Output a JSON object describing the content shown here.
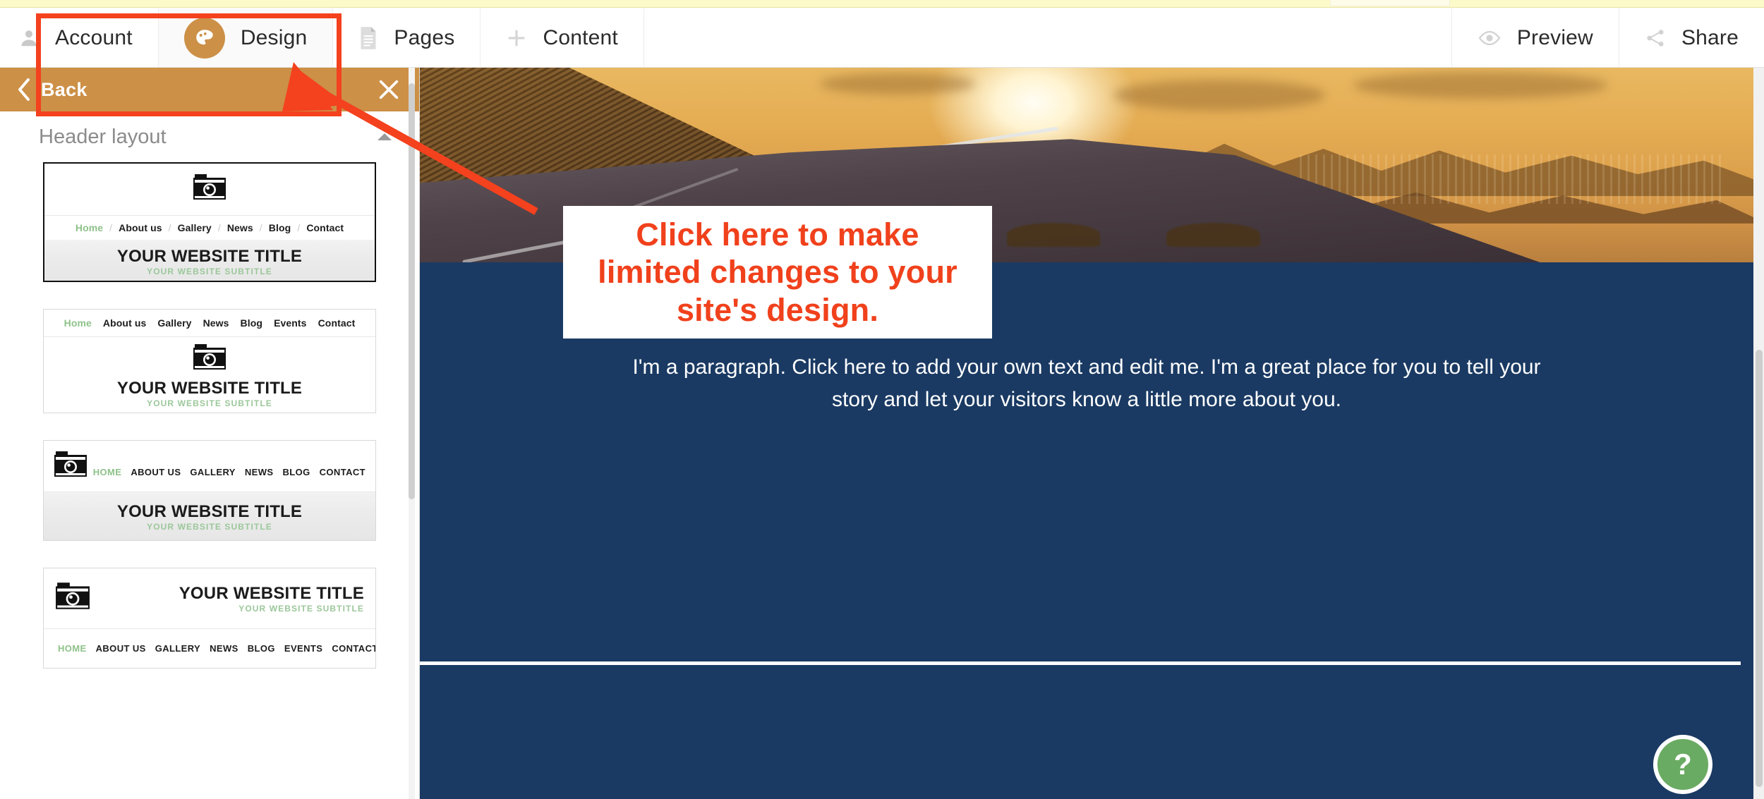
{
  "topbar": {
    "left_items": [
      {
        "label": "Account",
        "icon": "person-icon"
      },
      {
        "label": "Design",
        "icon": "palette-icon"
      },
      {
        "label": "Pages",
        "icon": "document-icon"
      },
      {
        "label": "Content",
        "icon": "plus-icon"
      }
    ],
    "right_items": [
      {
        "label": "Preview",
        "icon": "eye-icon"
      },
      {
        "label": "Share",
        "icon": "share-icon"
      }
    ],
    "active_item": "Design"
  },
  "panel": {
    "back_label": "Back",
    "close_label": "×",
    "section_title": "Header layout",
    "collapse_state": "expanded",
    "layouts": [
      {
        "id": "layout-1",
        "selected": true,
        "logo": "camera-icon",
        "nav": [
          "Home",
          "About us",
          "Gallery",
          "News",
          "Blog",
          "Contact"
        ],
        "nav_separator": "/",
        "nav_style": "mixed-case",
        "title": "YOUR WEBSITE TITLE",
        "subtitle": "YOUR WEBSITE SUBTITLE",
        "order": "logo-nav-banner"
      },
      {
        "id": "layout-2",
        "selected": false,
        "logo": "camera-icon",
        "nav": [
          "Home",
          "About us",
          "Gallery",
          "News",
          "Blog",
          "Events",
          "Contact"
        ],
        "nav_separator": "",
        "nav_style": "mixed-case",
        "title": "YOUR WEBSITE TITLE",
        "subtitle": "YOUR WEBSITE SUBTITLE",
        "order": "nav-logo-title"
      },
      {
        "id": "layout-3",
        "selected": false,
        "logo": "camera-icon",
        "nav": [
          "HOME",
          "ABOUT US",
          "GALLERY",
          "NEWS",
          "BLOG",
          "CONTACT"
        ],
        "nav_separator": "",
        "nav_style": "uppercase",
        "title": "YOUR WEBSITE TITLE",
        "subtitle": "YOUR WEBSITE SUBTITLE",
        "order": "logo-left-nav-right-banner"
      },
      {
        "id": "layout-4",
        "selected": false,
        "logo": "camera-icon",
        "nav": [
          "HOME",
          "ABOUT US",
          "GALLERY",
          "NEWS",
          "BLOG",
          "EVENTS",
          "CONTACT"
        ],
        "nav_separator": "",
        "nav_style": "uppercase",
        "title": "YOUR WEBSITE TITLE",
        "subtitle": "YOUR WEBSITE SUBTITLE",
        "order": "logo-left-title-right-nav-below"
      }
    ]
  },
  "site": {
    "hero_alt": "sunset mountain road with guardrail",
    "paragraph": "I'm a paragraph. Click here to add your own text and edit me. I'm a great place for you to tell your story and let your visitors know a little more about you.",
    "help_label": "?"
  },
  "annotation": {
    "callout_text": "Click here to make limited changes to your site's design.",
    "callout_lines": [
      "Click here to make",
      "limited changes to your",
      "site's design."
    ],
    "color": "#f0411c",
    "highlight_target": "Design"
  },
  "colors": {
    "accent_orange": "#cc9047",
    "site_blue": "#1a3a63",
    "annotation_red": "#f0411c",
    "help_green": "#6aab63",
    "top_strip_yellow": "#fcfac8"
  }
}
